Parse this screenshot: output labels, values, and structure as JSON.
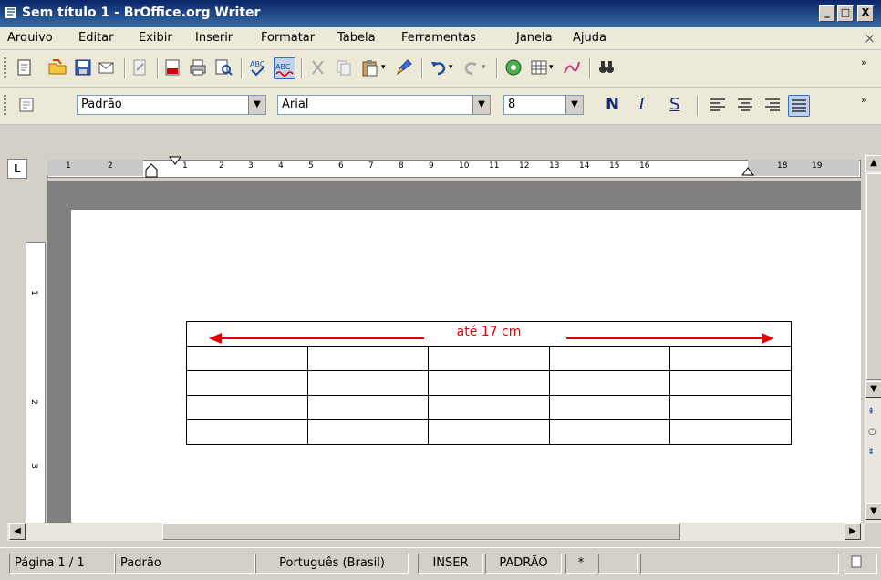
{
  "window": {
    "title": "Sem título 1 - BrOffice.org Writer",
    "min_label": "_",
    "max_label": "□",
    "close_label": "X"
  },
  "menu": {
    "items": [
      "Arquivo",
      "Editar",
      "Exibir",
      "Inserir",
      "Formatar",
      "Tabela",
      "Ferramentas",
      "Janela",
      "Ajuda"
    ],
    "close_doc": "×"
  },
  "formatting": {
    "style": "Padrão",
    "font": "Arial",
    "size": "8",
    "bold": "N",
    "italic": "I",
    "underline": "S"
  },
  "ruler": {
    "corner": "L",
    "numbers": [
      "1",
      "2",
      "1",
      "2",
      "3",
      "4",
      "5",
      "6",
      "7",
      "8",
      "9",
      "10",
      "11",
      "12",
      "13",
      "14",
      "15",
      "16",
      "18",
      "19"
    ]
  },
  "vruler": {
    "numbers": [
      "1",
      "2",
      "3"
    ]
  },
  "document": {
    "measure_label": "até 17 cm",
    "columns": 5,
    "body_rows": 4
  },
  "status": {
    "page": "Página 1 / 1",
    "style": "Padrão",
    "language": "Português (Brasil)",
    "insert_mode": "INSER",
    "selection_mode": "PADRÃO",
    "modified": "*"
  },
  "colors": {
    "accent": "#e00000",
    "titlebar": "#0a246a"
  }
}
